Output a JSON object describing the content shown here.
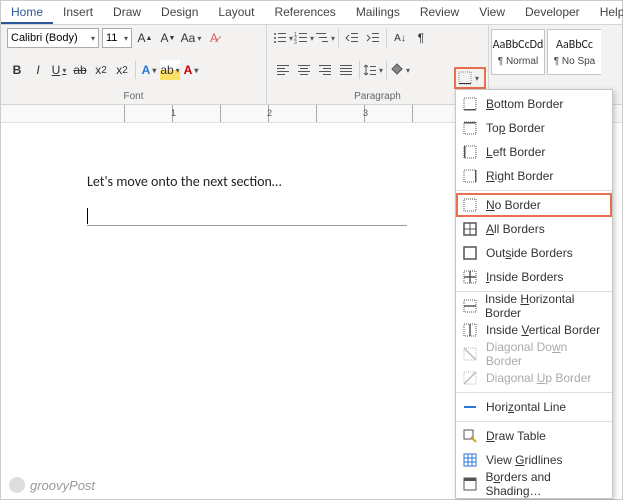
{
  "tabs": [
    "Home",
    "Insert",
    "Draw",
    "Design",
    "Layout",
    "References",
    "Mailings",
    "Review",
    "View",
    "Developer",
    "Help"
  ],
  "active_tab": "Home",
  "font": {
    "name": "Calibri (Body)",
    "size": "11"
  },
  "groups": {
    "font": "Font",
    "paragraph": "Paragraph"
  },
  "styles": [
    {
      "sample": "AaBbCcDd",
      "name": "¶ Normal"
    },
    {
      "sample": "AaBbCc",
      "name": "¶ No Spa"
    }
  ],
  "document": {
    "text": "Let's move onto the next section…"
  },
  "ruler": {
    "marks": [
      "1",
      "2",
      "3"
    ]
  },
  "border_menu": [
    {
      "label": "Bottom Border",
      "mn": "B",
      "icon": "bottom",
      "type": "item"
    },
    {
      "label": "Top Border",
      "mn": "P",
      "icon": "top",
      "type": "item"
    },
    {
      "label": "Left Border",
      "mn": "L",
      "icon": "left",
      "type": "item"
    },
    {
      "label": "Right Border",
      "mn": "R",
      "icon": "right",
      "type": "item"
    },
    {
      "type": "sep"
    },
    {
      "label": "No Border",
      "mn": "N",
      "icon": "none",
      "type": "item",
      "highlighted": true
    },
    {
      "label": "All Borders",
      "mn": "A",
      "icon": "all",
      "type": "item"
    },
    {
      "label": "Outside Borders",
      "mn": "S",
      "icon": "outside",
      "type": "item"
    },
    {
      "label": "Inside Borders",
      "mn": "I",
      "icon": "inside",
      "type": "item"
    },
    {
      "type": "sep"
    },
    {
      "label": "Inside Horizontal Border",
      "mn": "H",
      "icon": "inh",
      "type": "item"
    },
    {
      "label": "Inside Vertical Border",
      "mn": "V",
      "icon": "inv",
      "type": "item"
    },
    {
      "label": "Diagonal Down Border",
      "mn": "W",
      "icon": "diagd",
      "type": "item",
      "disabled": true
    },
    {
      "label": "Diagonal Up Border",
      "mn": "U",
      "icon": "diagu",
      "type": "item",
      "disabled": true
    },
    {
      "type": "sep"
    },
    {
      "label": "Horizontal Line",
      "mn": "Z",
      "icon": "hline",
      "type": "item"
    },
    {
      "type": "sep"
    },
    {
      "label": "Draw Table",
      "mn": "D",
      "icon": "draw",
      "type": "item"
    },
    {
      "label": "View Gridlines",
      "mn": "G",
      "icon": "grid",
      "type": "item"
    },
    {
      "label": "Borders and Shading…",
      "mn": "O",
      "icon": "dialog",
      "type": "item"
    }
  ],
  "watermark": "groovyPost"
}
